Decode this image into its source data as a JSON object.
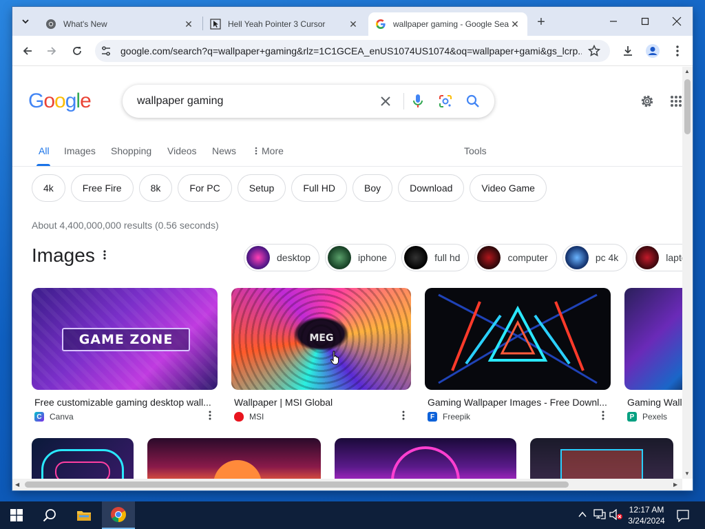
{
  "browser": {
    "tabs": [
      {
        "title": "What's New",
        "favicon": "chrome-icon"
      },
      {
        "title": "Hell Yeah Pointer 3 Cursor",
        "favicon": "cursor-file-icon"
      },
      {
        "title": "wallpaper gaming - Google Sea",
        "favicon": "google-g-icon",
        "active": true
      }
    ],
    "url": "google.com/search?q=wallpaper+gaming&rlz=1C1GCEA_enUS1074US1074&oq=wallpaper+gami&gs_lcrp..."
  },
  "google": {
    "logo": "Google",
    "query": "wallpaper gaming",
    "nav": {
      "all": "All",
      "images": "Images",
      "shopping": "Shopping",
      "videos": "Videos",
      "news": "News",
      "more": "More",
      "tools": "Tools"
    },
    "chips": [
      "4k",
      "Free Fire",
      "8k",
      "For PC",
      "Setup",
      "Full HD",
      "Boy",
      "Download",
      "Video Game"
    ],
    "stats": "About 4,400,000,000 results (0.56 seconds)",
    "images_heading": "Images",
    "related": [
      "desktop",
      "iphone",
      "full hd",
      "computer",
      "pc 4k",
      "laptop"
    ],
    "results": [
      {
        "caption": "Free customizable gaming desktop wall...",
        "source": "Canva",
        "overlay": "GAME ZONE"
      },
      {
        "caption": "Wallpaper | MSI Global",
        "source": "MSI",
        "overlay": "MEG"
      },
      {
        "caption": "Gaming Wallpaper Images - Free Downl...",
        "source": "Freepik"
      },
      {
        "caption": "Gaming Wall",
        "source": "Pexels"
      }
    ]
  },
  "taskbar": {
    "time": "12:17 AM",
    "date": "3/24/2024"
  },
  "colors": {
    "google_blue": "#4285F4",
    "google_red": "#EA4335",
    "google_yellow": "#FBBC05",
    "google_green": "#34A853",
    "link_blue": "#1a73e8"
  }
}
